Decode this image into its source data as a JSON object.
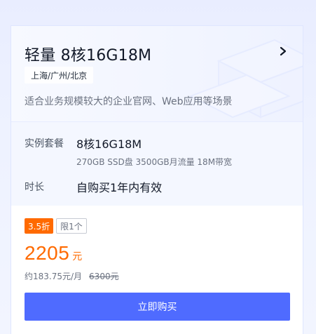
{
  "card": {
    "title": "轻量 8核16G18M",
    "region_badge": "上海/广州/北京",
    "description": "适合业务规模较大的企业官网、Web应用等场景"
  },
  "spec": {
    "instance_label": "实例套餐",
    "instance_value": "8核16G18M",
    "instance_detail": "270GB SSD盘 3500GB月流量 18M带宽",
    "duration_label": "时长",
    "duration_value": "自购买1年内有效"
  },
  "pricing": {
    "discount_tag": "3.5折",
    "limit_tag": "限1个",
    "price": "2205",
    "price_unit": "元",
    "monthly_price": "约183.75元/月",
    "original_price": "6300元"
  },
  "actions": {
    "buy_label": "立即购买"
  },
  "icons": {
    "detail": "chevron-right-icon"
  },
  "colors": {
    "accent": "#ff6a00",
    "primary_button": "#4f6bff",
    "text_primary": "#111827",
    "text_secondary": "#6b7280"
  }
}
